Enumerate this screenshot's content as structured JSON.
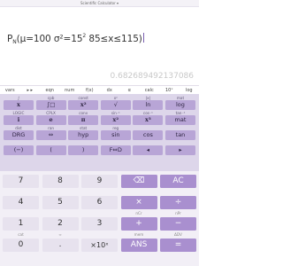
{
  "app": {
    "title": "Scientific Calculator ▾"
  },
  "display": {
    "expr_main": "P",
    "expr_sub": "N",
    "expr_body_1": "(μ=100  σ²=15",
    "expr_sup": "2",
    "expr_body_2": "  85≤x≤115)",
    "result": "0.682689492137086"
  },
  "tabs": [
    "vars",
    "▸ ▸",
    "eqn",
    "num",
    "f(x)",
    "dx",
    "α",
    "calc",
    "10ˣ",
    "log"
  ],
  "sci_rows": [
    {
      "secondary": [
        "∫",
        "cpb",
        "const",
        "x²",
        "|x|",
        "mat"
      ],
      "buttons": [
        "x",
        "∫□",
        "x²",
        "√",
        "ln",
        "log"
      ]
    },
    {
      "secondary": [
        "LOGIC",
        "CPLX",
        "conv",
        "sin⁻¹",
        "cos⁻¹",
        "tan⁻¹"
      ],
      "buttons": [
        "i",
        "e",
        "π",
        "x²",
        "x³",
        "mat"
      ]
    },
    {
      "secondary": [
        "dist",
        "ran",
        "stat",
        "reg",
        "",
        ""
      ],
      "buttons": [
        "DRG",
        "⇔",
        "hyp",
        "sin",
        "cos",
        "tan"
      ]
    },
    {
      "secondary": [
        "",
        "",
        "",
        "",
        "",
        ""
      ],
      "buttons": [
        "(−)",
        "(",
        ")",
        "F⇔D",
        "◂",
        "▸"
      ]
    }
  ],
  "num_rows": [
    {
      "secondary": [
        "",
        "",
        "",
        "",
        ""
      ],
      "buttons": [
        "7",
        "8",
        "9",
        "⌫",
        "AC"
      ]
    },
    {
      "secondary": [
        "",
        "",
        "",
        "",
        ""
      ],
      "buttons": [
        "4",
        "5",
        "6",
        "×",
        "÷"
      ]
    },
    {
      "secondary": [
        "",
        "",
        "",
        "nCr",
        "nPr"
      ],
      "buttons": [
        "1",
        "2",
        "3",
        "+",
        "−"
      ]
    },
    {
      "secondary": [
        "cat",
        "∞",
        "",
        "mem",
        "ΔDV"
      ],
      "buttons": [
        "0",
        ".",
        "×10ˣ",
        "ANS",
        "="
      ]
    }
  ]
}
